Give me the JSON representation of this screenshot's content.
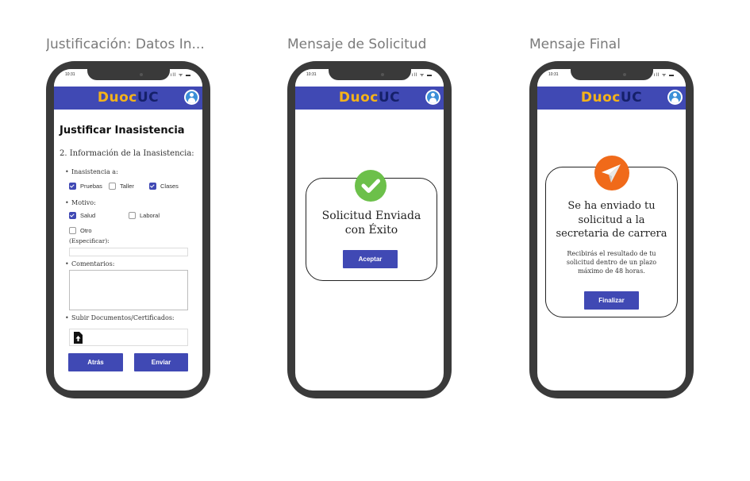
{
  "frames": [
    {
      "title": "Justificación: Datos In..."
    },
    {
      "title": "Mensaje de Solicitud"
    },
    {
      "title": "Mensaje Final"
    }
  ],
  "statusbar": {
    "time": "10:31",
    "icons": "ıll ᯤ ▬"
  },
  "brand": {
    "duoc": "Duoc",
    "uc": "UC",
    "primary": "#4049b4",
    "accent": "#f4b31a"
  },
  "form": {
    "title": "Justificar Inasistencia",
    "section": "2. Información de la Inasistencia:",
    "inasistencia_label": "Inasistencia a:",
    "inasistencia_options": [
      {
        "label": "Pruebas",
        "checked": true
      },
      {
        "label": "Taller",
        "checked": false
      },
      {
        "label": "Clases",
        "checked": true
      }
    ],
    "motivo_label": "Motivo:",
    "motivo_options": [
      {
        "label": "Salud",
        "checked": true
      },
      {
        "label": "Laboral",
        "checked": false
      },
      {
        "label": "Otro",
        "checked": false
      }
    ],
    "especificar_label": "(Especificar):",
    "comentarios_label": "Comentarios:",
    "upload_label": "Subir Documentos/Certificados:",
    "back_button": "Atrás",
    "send_button": "Enviar"
  },
  "dialog_success": {
    "message": "Solicitud Enviada con Éxito",
    "accept_button": "Aceptar"
  },
  "dialog_final": {
    "headline": "Se ha enviado tu solicitud a la secretaria de carrera",
    "body": "Recibirás el resultado de tu solicitud dentro de un plazo máximo de 48 horas.",
    "finish_button": "Finalizar"
  }
}
